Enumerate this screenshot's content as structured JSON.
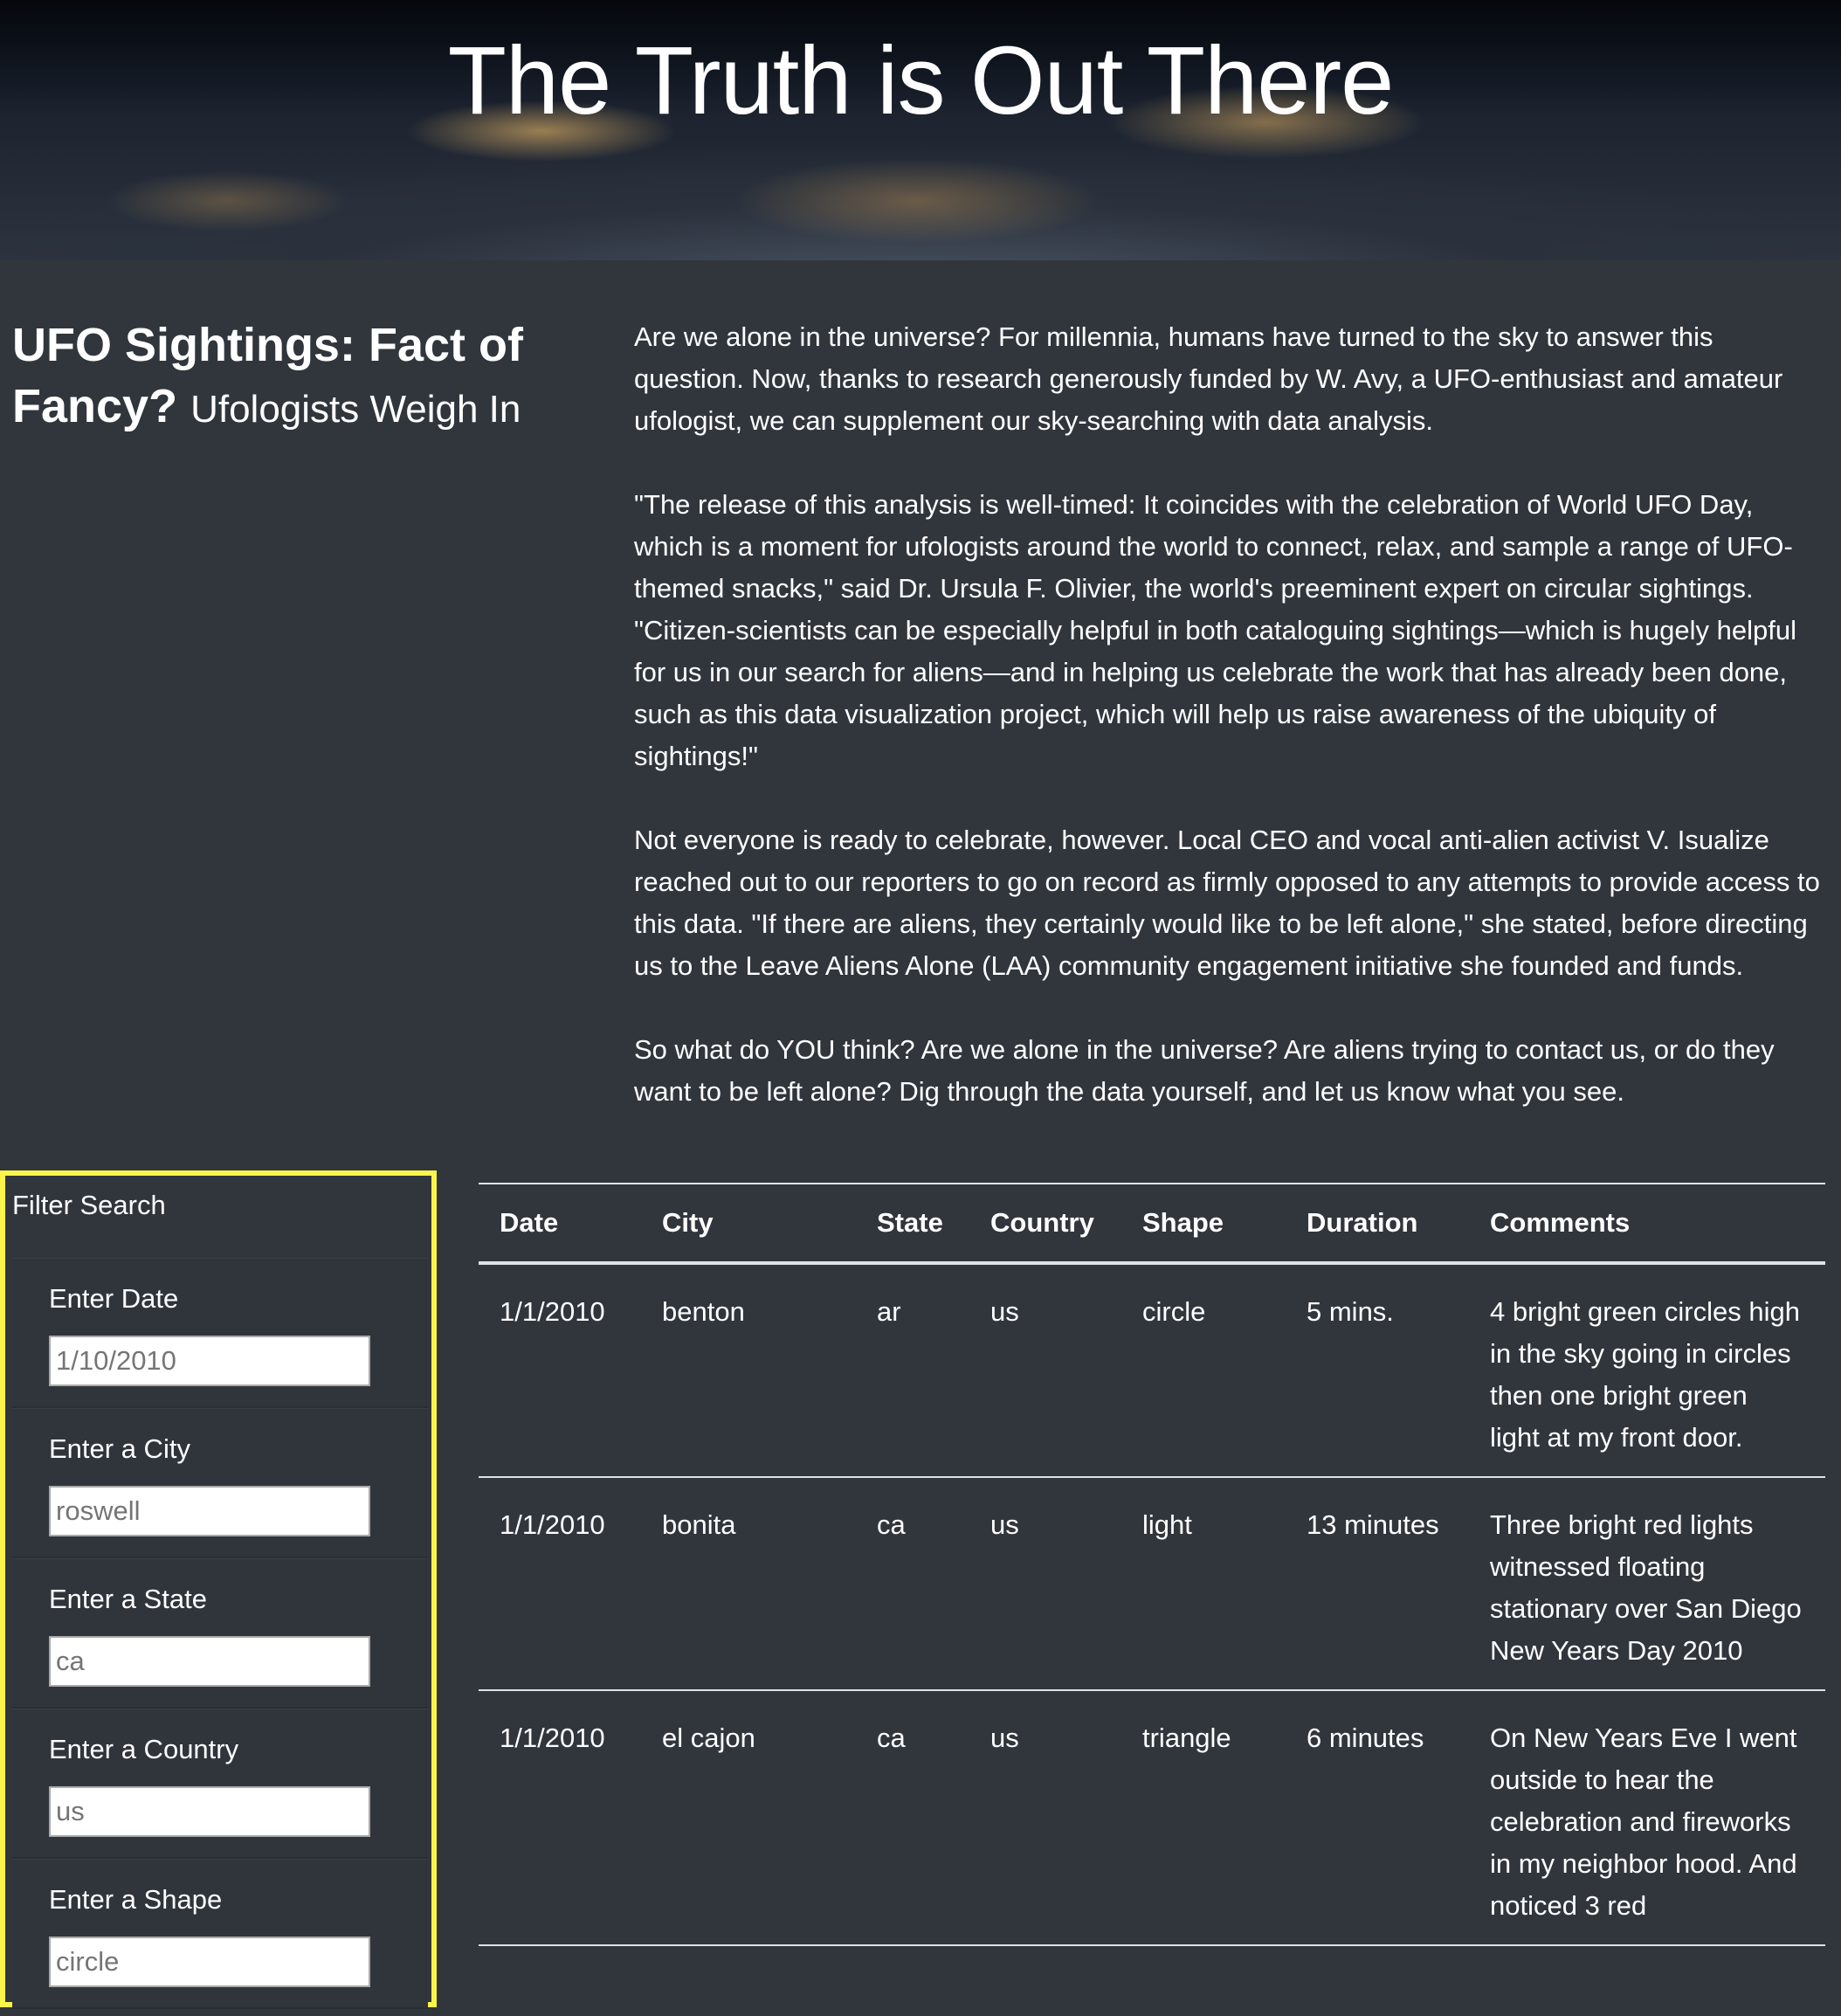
{
  "hero": {
    "title": "The Truth is Out There"
  },
  "sidebar_heading": {
    "title": "UFO Sightings: Fact of Fancy?",
    "subtitle": "Ufologists Weigh In"
  },
  "article": {
    "paragraphs": [
      "Are we alone in the universe? For millennia, humans have turned to the sky to answer this question. Now, thanks to research generously funded by W. Avy, a UFO-enthusiast and amateur ufologist, we can supplement our sky-searching with data analysis.",
      "\"The release of this analysis is well-timed: It coincides with the celebration of World UFO Day, which is a moment for ufologists around the world to connect, relax, and sample a range of UFO-themed snacks,\" said Dr. Ursula F. Olivier, the world's preeminent expert on circular sightings. \"Citizen-scientists can be especially helpful in both cataloguing sightings—which is hugely helpful for us in our search for aliens—and in helping us celebrate the work that has already been done, such as this data visualization project, which will help us raise awareness of the ubiquity of sightings!\"",
      "Not everyone is ready to celebrate, however. Local CEO and vocal anti-alien activist V. Isualize reached out to our reporters to go on record as firmly opposed to any attempts to provide access to this data. \"If there are aliens, they certainly would like to be left alone,\" she stated, before directing us to the Leave Aliens Alone (LAA) community engagement initiative she founded and funds.",
      "So what do YOU think? Are we alone in the universe? Are aliens trying to contact us, or do they want to be left alone? Dig through the data yourself, and let us know what you see."
    ]
  },
  "filters": {
    "title": "Filter Search",
    "items": [
      {
        "label": "Enter Date",
        "placeholder": "1/10/2010"
      },
      {
        "label": "Enter a City",
        "placeholder": "roswell"
      },
      {
        "label": "Enter a State",
        "placeholder": "ca"
      },
      {
        "label": "Enter a Country",
        "placeholder": "us"
      },
      {
        "label": "Enter a Shape",
        "placeholder": "circle"
      }
    ]
  },
  "table": {
    "headers": [
      "Date",
      "City",
      "State",
      "Country",
      "Shape",
      "Duration",
      "Comments"
    ],
    "rows": [
      [
        "1/1/2010",
        "benton",
        "ar",
        "us",
        "circle",
        "5 mins.",
        "4 bright green circles high in the sky going in circles then one bright green light at my front door."
      ],
      [
        "1/1/2010",
        "bonita",
        "ca",
        "us",
        "light",
        "13 minutes",
        "Three bright red lights witnessed floating stationary over San Diego New Years Day 2010"
      ],
      [
        "1/1/2010",
        "el cajon",
        "ca",
        "us",
        "triangle",
        "6 minutes",
        "On New Years Eve I went outside to hear the celebration and fireworks in my neighbor hood. And noticed 3 red"
      ]
    ]
  }
}
